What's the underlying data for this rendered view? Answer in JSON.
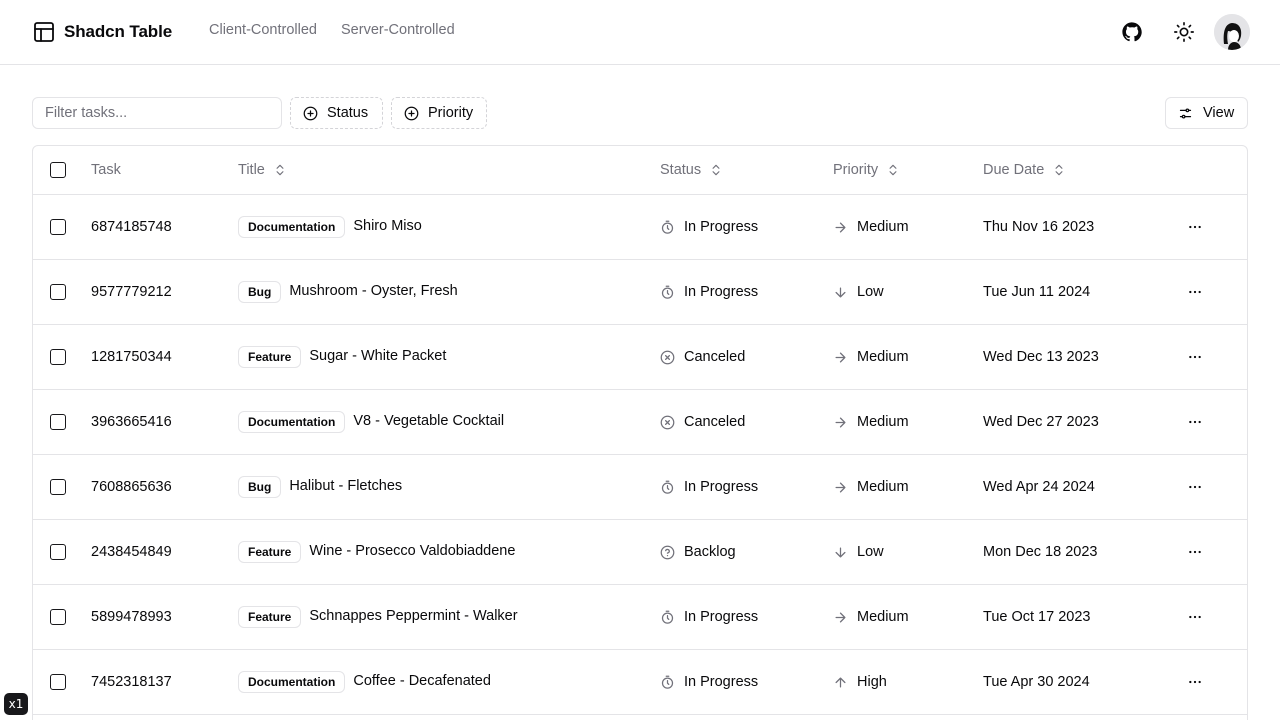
{
  "header": {
    "brand": "Shadcn Table",
    "nav": [
      "Client-Controlled",
      "Server-Controlled"
    ],
    "icons": {
      "logo": "table-icon",
      "github": "github-icon",
      "theme": "sun-icon",
      "avatar": "avatar-image"
    }
  },
  "toolbar": {
    "filter_placeholder": "Filter tasks...",
    "status_label": "Status",
    "priority_label": "Priority",
    "view_label": "View"
  },
  "table": {
    "columns": {
      "task": "Task",
      "title": "Title",
      "status": "Status",
      "priority": "Priority",
      "due": "Due Date"
    },
    "rows": [
      {
        "task": "6874185748",
        "label": "Documentation",
        "title": "Shiro Miso",
        "status": "In Progress",
        "status_icon": "timer",
        "priority": "Medium",
        "priority_icon": "arrow-right",
        "due": "Thu Nov 16 2023"
      },
      {
        "task": "9577779212",
        "label": "Bug",
        "title": "Mushroom - Oyster, Fresh",
        "status": "In Progress",
        "status_icon": "timer",
        "priority": "Low",
        "priority_icon": "arrow-down",
        "due": "Tue Jun 11 2024"
      },
      {
        "task": "1281750344",
        "label": "Feature",
        "title": "Sugar - White Packet",
        "status": "Canceled",
        "status_icon": "circle-x",
        "priority": "Medium",
        "priority_icon": "arrow-right",
        "due": "Wed Dec 13 2023"
      },
      {
        "task": "3963665416",
        "label": "Documentation",
        "title": "V8 - Vegetable Cocktail",
        "status": "Canceled",
        "status_icon": "circle-x",
        "priority": "Medium",
        "priority_icon": "arrow-right",
        "due": "Wed Dec 27 2023"
      },
      {
        "task": "7608865636",
        "label": "Bug",
        "title": "Halibut - Fletches",
        "status": "In Progress",
        "status_icon": "timer",
        "priority": "Medium",
        "priority_icon": "arrow-right",
        "due": "Wed Apr 24 2024"
      },
      {
        "task": "2438454849",
        "label": "Feature",
        "title": "Wine - Prosecco Valdobiaddene",
        "status": "Backlog",
        "status_icon": "circle-help",
        "priority": "Low",
        "priority_icon": "arrow-down",
        "due": "Mon Dec 18 2023"
      },
      {
        "task": "5899478993",
        "label": "Feature",
        "title": "Schnappes Peppermint - Walker",
        "status": "In Progress",
        "status_icon": "timer",
        "priority": "Medium",
        "priority_icon": "arrow-right",
        "due": "Tue Oct 17 2023"
      },
      {
        "task": "7452318137",
        "label": "Documentation",
        "title": "Coffee - Decafenated",
        "status": "In Progress",
        "status_icon": "timer",
        "priority": "High",
        "priority_icon": "arrow-up",
        "due": "Tue Apr 30 2024"
      }
    ]
  },
  "corner_badge": "x1"
}
